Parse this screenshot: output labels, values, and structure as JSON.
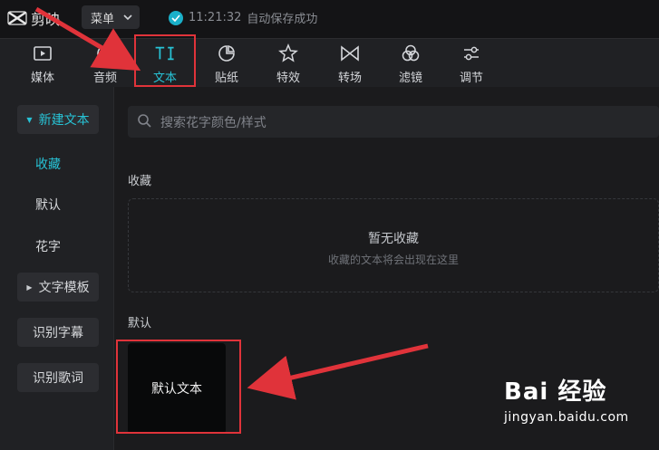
{
  "app": {
    "name": "剪映"
  },
  "titlebar": {
    "menu_label": "菜单",
    "save_time": "11:21:32",
    "save_text": "自动保存成功"
  },
  "toolbar": {
    "items": [
      {
        "label": "媒体",
        "icon": "media-icon"
      },
      {
        "label": "音频",
        "icon": "audio-icon"
      },
      {
        "label": "文本",
        "icon": "text-icon",
        "active": true
      },
      {
        "label": "贴纸",
        "icon": "sticker-icon"
      },
      {
        "label": "特效",
        "icon": "effects-icon"
      },
      {
        "label": "转场",
        "icon": "transition-icon"
      },
      {
        "label": "滤镜",
        "icon": "filter-icon"
      },
      {
        "label": "调节",
        "icon": "adjust-icon"
      }
    ]
  },
  "sidebar": {
    "new_text": "新建文本",
    "favorites": "收藏",
    "default": "默认",
    "fancy": "花字",
    "templates": "文字模板",
    "subtitles": "识别字幕",
    "lyrics": "识别歌词"
  },
  "search": {
    "placeholder": "搜索花字颜色/样式"
  },
  "favorites_section": {
    "label": "收藏",
    "empty_title": "暂无收藏",
    "empty_sub": "收藏的文本将会出现在这里"
  },
  "default_section": {
    "label": "默认",
    "card_text": "默认文本"
  },
  "watermark": {
    "brand_text": "Bai  经验",
    "url": "jingyan.baidu.com"
  },
  "colors": {
    "accent": "#27c3d6",
    "annotation": "#e0333a",
    "background": "#1b1b1d",
    "panel": "#202124"
  }
}
